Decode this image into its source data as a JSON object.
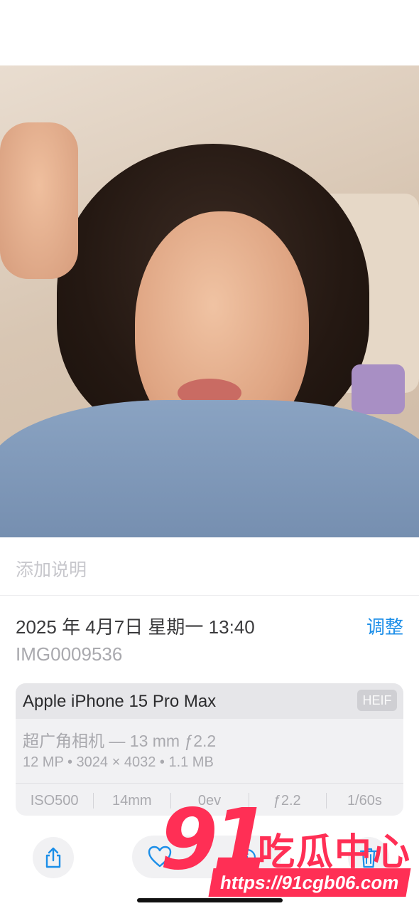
{
  "caption": {
    "placeholder": "添加说明"
  },
  "info": {
    "date": "2025 年 4月7日 星期一 13:40",
    "adjust_label": "调整",
    "filename": "IMG0009536"
  },
  "camera": {
    "device": "Apple iPhone 15 Pro Max",
    "format": "HEIF",
    "lens": "超广角相机 — 13 mm ƒ2.2",
    "specs": "12 MP • 3024 × 4032 • 1.1 MB",
    "exif": [
      "ISO500",
      "14mm",
      "0ev",
      "ƒ2.2",
      "1/60s"
    ]
  },
  "toolbar": {
    "share_icon": "share-icon",
    "favorite_icon": "heart-icon",
    "info_icon": "info-icon",
    "delete_icon": "trash-icon"
  },
  "watermark": {
    "number": "91",
    "brand": "吃瓜中心",
    "url": "https://91cgb06.com"
  },
  "colors": {
    "accent": "#1b8ee8",
    "watermark": "#ff2f55"
  }
}
